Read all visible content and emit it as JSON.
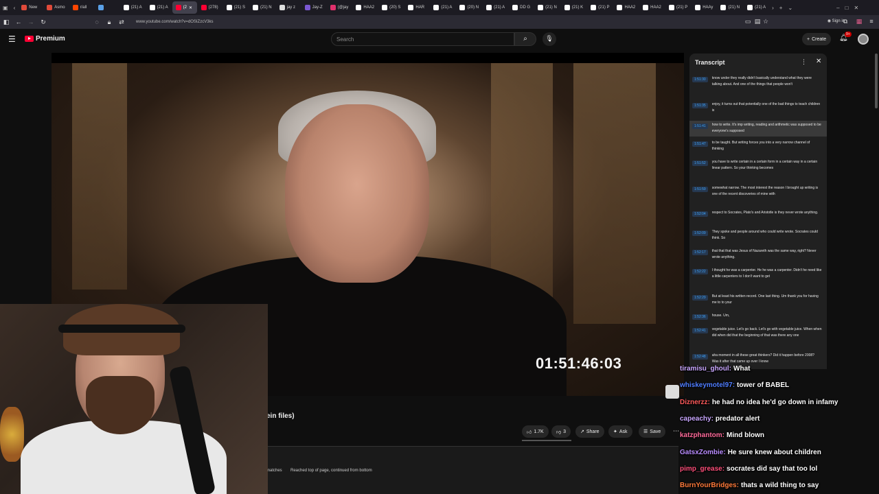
{
  "browser": {
    "tabs": [
      {
        "label": "New",
        "color": "#e04a3a",
        "active": false
      },
      {
        "label": "Asmo",
        "color": "#e04a3a",
        "active": false
      },
      {
        "label": "r/all",
        "color": "#ff4500",
        "active": false
      },
      {
        "label": "",
        "color": "#5aa0e6",
        "active": false
      },
      {
        "label": "(21) A",
        "color": "#ffffff",
        "active": false
      },
      {
        "label": "(21) A",
        "color": "#ffffff",
        "active": false
      },
      {
        "label": "(2",
        "color": "#ff0033",
        "active": true
      },
      {
        "label": "(278)",
        "color": "#ff0033",
        "active": false
      },
      {
        "label": "(21) S",
        "color": "#ffffff",
        "active": false
      },
      {
        "label": "(21) N",
        "color": "#ffffff",
        "active": false
      },
      {
        "label": "jay z",
        "color": "#dddddd",
        "active": false
      },
      {
        "label": "Jay-Z",
        "color": "#7a57d1",
        "active": false
      },
      {
        "label": "(@jay",
        "color": "#e1306c",
        "active": false
      },
      {
        "label": "HAA2",
        "color": "#ffffff",
        "active": false
      },
      {
        "label": "(20) S",
        "color": "#ffffff",
        "active": false
      },
      {
        "label": "HAR",
        "color": "#ffffff",
        "active": false
      },
      {
        "label": "(21) A",
        "color": "#ffffff",
        "active": false
      },
      {
        "label": "(20) N",
        "color": "#ffffff",
        "active": false
      },
      {
        "label": "(21) A",
        "color": "#ffffff",
        "active": false
      },
      {
        "label": "DD G",
        "color": "#ffffff",
        "active": false
      },
      {
        "label": "(21) N",
        "color": "#ffffff",
        "active": false
      },
      {
        "label": "(21) K",
        "color": "#ffffff",
        "active": false
      },
      {
        "label": "(21) P",
        "color": "#ffffff",
        "active": false
      },
      {
        "label": "HAA2",
        "color": "#ffffff",
        "active": false
      },
      {
        "label": "HAA2",
        "color": "#ffffff",
        "active": false
      },
      {
        "label": "(21) P",
        "color": "#ffffff",
        "active": false
      },
      {
        "label": "HAAy",
        "color": "#ffffff",
        "active": false
      },
      {
        "label": "(21) N",
        "color": "#ffffff",
        "active": false
      },
      {
        "label": "(21) A",
        "color": "#ffffff",
        "active": false
      }
    ],
    "url": "www.youtube.com/watch?v=dOSIZzcV3ks",
    "signin": "Sign in"
  },
  "youtube": {
    "logo": "Premium",
    "search_placeholder": "Search",
    "create_label": "Create",
    "bell_badge": "9+",
    "video_title_fragment": "ein files)",
    "actions": {
      "like": "1.7K",
      "dislike": "3",
      "share": "Share",
      "ask": "Ask",
      "save": "Save"
    }
  },
  "video": {
    "timecode": "01:51:46:03"
  },
  "transcript": {
    "title": "Transcript",
    "segments": [
      {
        "t": "1:51:30",
        "text": "know under they really didn't basically understand what they were talking about. And one of the things that people won't",
        "hl": false
      },
      {
        "t": "1:51:35",
        "text": "enjoy, it turns out that potentially one of the bad things to teach children is",
        "hl": false
      },
      {
        "t": "1:51:41",
        "text": "how to write. It's imp writing, reading and arithmetic was supposed to be everyone's supposed",
        "hl": true
      },
      {
        "t": "1:51:47",
        "text": "to be taught. But writing forces you into a very narrow channel of thinking",
        "hl": false
      },
      {
        "t": "1:51:52",
        "text": "you have to write certain in a certain form in a certain way in a certain linear pattern. So your thinking becomes",
        "hl": false
      },
      {
        "t": "1:51:59",
        "text": "somewhat narrow. The most interest the reason I brought up writing is one of the recent discoveries of mine with",
        "hl": false
      },
      {
        "t": "1:52:04",
        "text": "respect to Socrates, Plato's and Aristotle is they never wrote anything.",
        "hl": false
      },
      {
        "t": "1:52:09",
        "text": "They spoke and people around who could write wrote. Socrates could think. So",
        "hl": false
      },
      {
        "t": "1:52:17",
        "text": "that that that was Jesus of Nazareth was the same way, right? Never wrote anything.",
        "hl": false
      },
      {
        "t": "1:52:22",
        "text": "I thought he was a carpenter. He he was a carpenter. Didn't he need like a little carpenters to I don't want to get",
        "hl": false
      },
      {
        "t": "1:52:29",
        "text": "But at least his written record. One last thing. Um thank you for having me to to your",
        "hl": false
      },
      {
        "t": "1:52:36",
        "text": "house. Um,",
        "hl": false
      },
      {
        "t": "1:52:41",
        "text": "vegetable juice. Let's go back. Let's go with vegetable juice. When when did when did that the beginning of that was there any one",
        "hl": false
      },
      {
        "t": "1:52:48",
        "text": "aha moment in all these great thinkers? Did it happen before 2008? Was it after that came up over I know",
        "hl": false
      }
    ]
  },
  "find": {
    "matches": "matches",
    "message": "Reached top of page, continued from bottom"
  },
  "chat": [
    {
      "user": "tiramisu_ghoul:",
      "msg": "What",
      "color": "#c9a7ff"
    },
    {
      "user": "whiskeymotel97:",
      "msg": "tower of BABEL",
      "color": "#4f7dff"
    },
    {
      "user": "Diznerzz:",
      "msg": "he had no idea he'd go down in infamy",
      "color": "#ff5a5a"
    },
    {
      "user": "capeachy:",
      "msg": "predator alert",
      "color": "#c9a7ff"
    },
    {
      "user": "katzphantom:",
      "msg": "Mind blown",
      "color": "#ff6b9a"
    },
    {
      "user": "GatsxZombie:",
      "msg": "He sure knew about children",
      "color": "#b98cff"
    },
    {
      "user": "pimp_grease:",
      "msg": "socrates did say that too lol",
      "color": "#ff4f7a"
    },
    {
      "user": "BurnYourBridges:",
      "msg": "thats a wild thing to say",
      "color": "#ff7a3a"
    }
  ]
}
